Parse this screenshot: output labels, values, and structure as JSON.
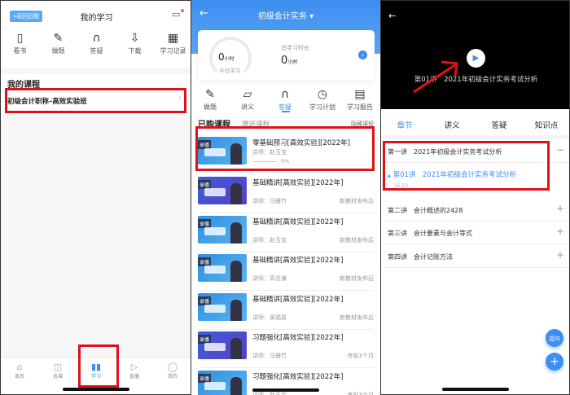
{
  "left": {
    "back_old_label": "«返回旧版",
    "title": "我的学习",
    "tools": [
      {
        "icon": "book-icon",
        "glyph": "▯",
        "label": "看书"
      },
      {
        "icon": "exercise-icon",
        "glyph": "✎",
        "label": "做题"
      },
      {
        "icon": "headphones-icon",
        "glyph": "∩",
        "label": "答疑"
      },
      {
        "icon": "download-icon",
        "glyph": "⇩",
        "label": "下载"
      },
      {
        "icon": "calendar-icon",
        "glyph": "▦",
        "label": "学习记录"
      }
    ],
    "section": "我的课程",
    "course": "初级会计职称–高效实验班",
    "nav": [
      {
        "glyph": "⌂",
        "label": "首页"
      },
      {
        "glyph": "◫",
        "label": "选课"
      },
      {
        "glyph": "▮▮",
        "label": "学习",
        "active": true
      },
      {
        "glyph": "▷",
        "label": "直播"
      },
      {
        "glyph": "◯",
        "label": "我的"
      }
    ]
  },
  "middle": {
    "title": "初级会计实务 ▾",
    "today_value": "0",
    "today_unit": "小时",
    "today_label": "今日学习",
    "total_label": "总学习时长",
    "total_value": "0",
    "total_unit": "小时",
    "tools": [
      {
        "glyph": "✎",
        "label": "做题"
      },
      {
        "glyph": "▱",
        "label": "讲义"
      },
      {
        "glyph": "∩",
        "label": "答疑"
      },
      {
        "glyph": "◷",
        "label": "学习计划"
      },
      {
        "glyph": "▤",
        "label": "学习报告"
      }
    ],
    "tab_active": "已购课程",
    "tab_other": "赠送课程",
    "hide_label": "隐藏课程",
    "first": {
      "tag": "录播",
      "title": "零基础预习[高效实验][2022年]",
      "teacher": "讲师：赵玉宝",
      "progress": "0%"
    },
    "courses": [
      {
        "tag": "录播",
        "title": "基础精讲[高效实验][2022年]",
        "teacher": "讲师：冯雅竹",
        "note": "新教材发布后",
        "style": "p"
      },
      {
        "tag": "录播",
        "title": "基础精讲[高效实验][2022年]",
        "teacher": "讲师：赵玉宝",
        "note": "新教材发布后",
        "style": "b"
      },
      {
        "tag": "录播",
        "title": "基础精讲[高效实验][2022年]",
        "teacher": "讲师：高志谦",
        "note": "新教材发布后",
        "style": "b"
      },
      {
        "tag": "录播",
        "title": "基础精讲[高效实验][2022年]",
        "teacher": "讲师：吴福喜",
        "note": "新教材发布后",
        "style": "b"
      },
      {
        "tag": "录播",
        "title": "习题强化[高效实验][2022年]",
        "teacher": "讲师：冯雅竹",
        "note": "考前3个月",
        "style": "p"
      },
      {
        "tag": "录播",
        "title": "习题强化[高效实验][2022年]",
        "teacher": "讲师：赵玉宝",
        "note": "考前3个月",
        "style": "b"
      }
    ]
  },
  "right": {
    "video_title": "第01讲　2021年初级会计实务考试分析",
    "tabs": [
      "章节",
      "讲义",
      "答疑",
      "知识点"
    ],
    "chapters": [
      {
        "title": "第一讲　2021年初级会计实务考试分析",
        "sign": "−"
      },
      {
        "title": "第二讲　会计概述的2428",
        "sign": "+"
      },
      {
        "title": "第三讲　会计要素与会计等式",
        "sign": "+"
      },
      {
        "title": "第四讲　会计记账方法",
        "sign": "+"
      }
    ],
    "lesson": "第01讲　2021年初级会计实务考试分析",
    "lesson_time": "35:22",
    "ask_label": "提问",
    "add_label": "+"
  },
  "colors": {
    "accent": "#3d8ef0",
    "highlight": "#e0101a"
  }
}
